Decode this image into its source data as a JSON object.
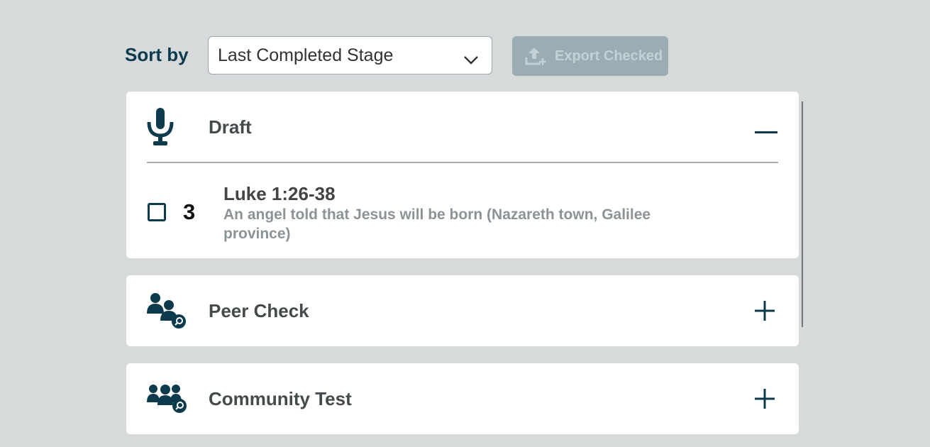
{
  "toolbar": {
    "sort_label": "Sort by",
    "sort_value": "Last Completed Stage",
    "export_label": "Export Checked"
  },
  "stages": [
    {
      "title": "Draft",
      "icon": "microphone-icon",
      "expanded": true,
      "items": [
        {
          "number": "3",
          "reference": "Luke 1:26-38",
          "description": "An angel told that Jesus will be born (Nazareth town, Galilee province)",
          "checked": false
        }
      ]
    },
    {
      "title": "Peer Check",
      "icon": "peer-check-icon",
      "expanded": false
    },
    {
      "title": "Community Test",
      "icon": "community-test-icon",
      "expanded": false
    }
  ],
  "colors": {
    "background": "#d6dadb",
    "accent": "#0d3b4d",
    "panel": "#ffffff",
    "export_disabled": "#9aadb5"
  }
}
